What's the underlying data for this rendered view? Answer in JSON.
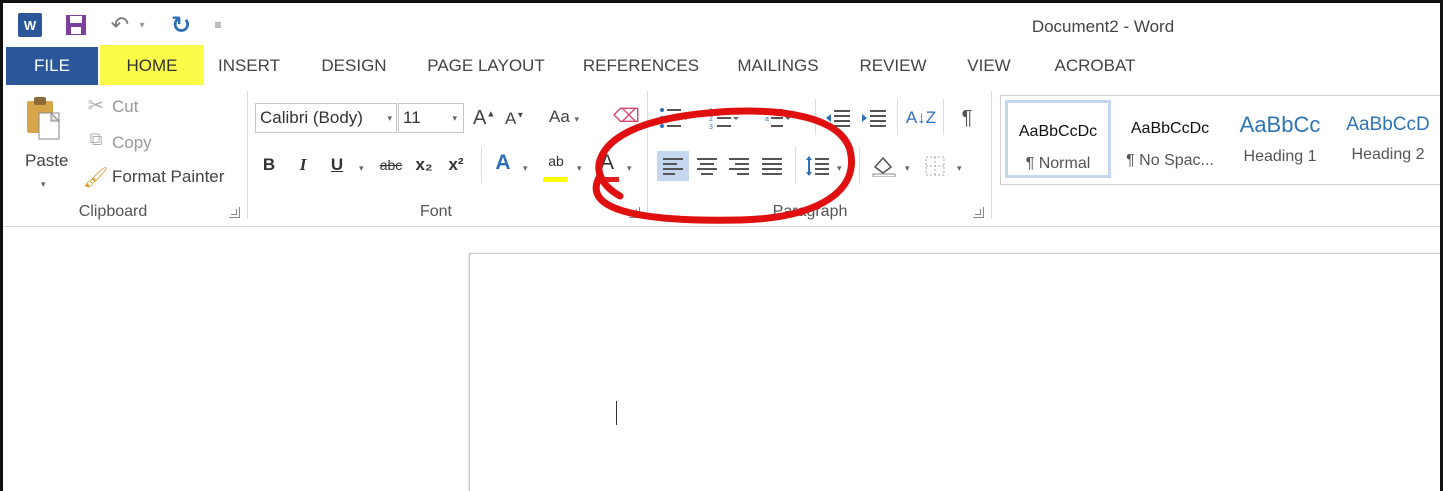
{
  "window": {
    "title": "Document2 - Word"
  },
  "qat": {
    "app_icon_text": "W"
  },
  "tabs": {
    "file": "FILE",
    "home": "HOME",
    "insert": "INSERT",
    "design": "DESIGN",
    "page_layout": "PAGE LAYOUT",
    "references": "REFERENCES",
    "mailings": "MAILINGS",
    "review": "REVIEW",
    "view": "VIEW",
    "acrobat": "ACROBAT"
  },
  "clipboard": {
    "paste": "Paste",
    "cut": "Cut",
    "copy": "Copy",
    "format_painter": "Format Painter",
    "group_label": "Clipboard"
  },
  "font": {
    "name": "Calibri (Body)",
    "size": "11",
    "change_case": "Aa",
    "bold": "B",
    "italic": "I",
    "underline": "U",
    "strikethrough": "abc",
    "subscript": "x₂",
    "superscript": "x²",
    "text_effects": "A",
    "highlight": "ab",
    "font_color": "A",
    "group_label": "Font"
  },
  "paragraph": {
    "sort": "A↓Z",
    "show_marks": "¶",
    "group_label": "Paragraph"
  },
  "styles": [
    {
      "preview": "AaBbCcDc",
      "name": "¶ Normal"
    },
    {
      "preview": "AaBbCcDc",
      "name": "¶ No Spac..."
    },
    {
      "preview": "AaBbCc",
      "name": "Heading 1"
    },
    {
      "preview": "AaBbCcD",
      "name": "Heading 2"
    }
  ],
  "colors": {
    "brand": "#2b579a",
    "home_tab_highlight": "#fbfb4a",
    "annotation": "#e01010",
    "selected_button": "#c5d7ee"
  }
}
